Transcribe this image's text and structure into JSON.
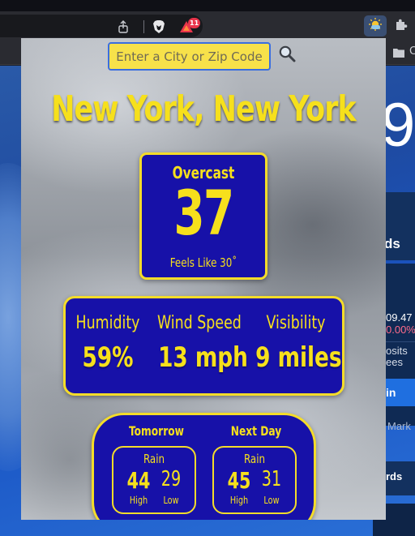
{
  "browser": {
    "rewards_badge_count": "11",
    "bookmark_folder_label": "C"
  },
  "background_page": {
    "big_text": "9",
    "snippet_1": "ds",
    "snippet_2": "09.47",
    "snippet_3": "0.00%",
    "snippet_4": "osits",
    "snippet_5": "ees",
    "snippet_6": "in",
    "snippet_7": "Mark",
    "snippet_8": "rds"
  },
  "search": {
    "placeholder": "Enter a City or Zip Code",
    "value": ""
  },
  "weather": {
    "location": "New York, New York",
    "condition": "Overcast",
    "temperature": "37",
    "feels_like": "Feels Like 30˚",
    "stats": {
      "humidity_label": "Humidity",
      "humidity_value": "59%",
      "wind_label": "Wind Speed",
      "wind_value": "13 mph",
      "visibility_label": "Visibility",
      "visibility_value": "9 miles"
    },
    "forecast": [
      {
        "day": "Tomorrow",
        "condition": "Rain",
        "high": "44",
        "low": "29",
        "high_label": "High",
        "low_label": "Low"
      },
      {
        "day": "Next Day",
        "condition": "Rain",
        "high": "45",
        "low": "31",
        "high_label": "High",
        "low_label": "Low"
      }
    ]
  },
  "colors": {
    "accent_yellow": "#f6e01c",
    "card_blue": "#1711a8",
    "input_border": "#3a6ee0"
  }
}
